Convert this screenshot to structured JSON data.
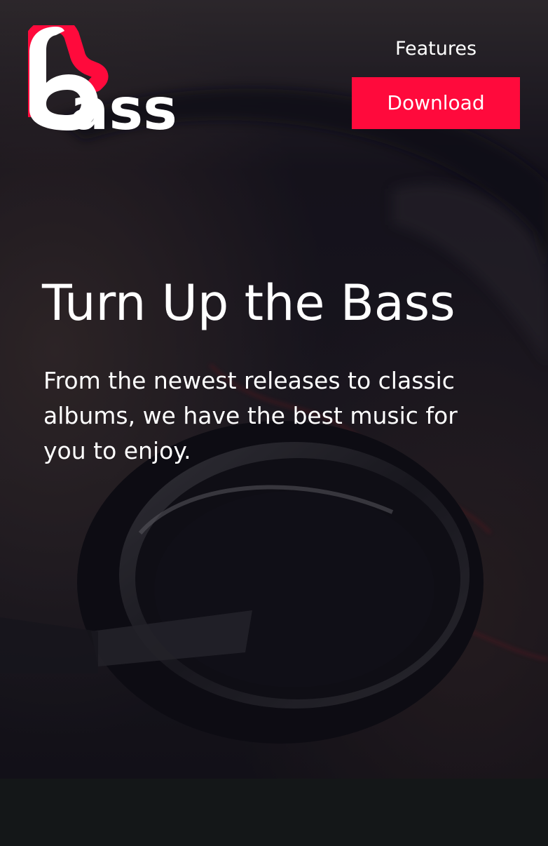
{
  "brand": {
    "name": "bass",
    "logo_text": "ass",
    "accent_color": "#ff0a3c",
    "logo_color": "#ffffff"
  },
  "nav": {
    "features_label": "Features",
    "download_label": "Download"
  },
  "hero": {
    "title": "Turn Up the Bass",
    "subtitle": "From the newest releases to classic albums, we have the best music for you to enjoy.",
    "background_image": "headphones-photo"
  }
}
